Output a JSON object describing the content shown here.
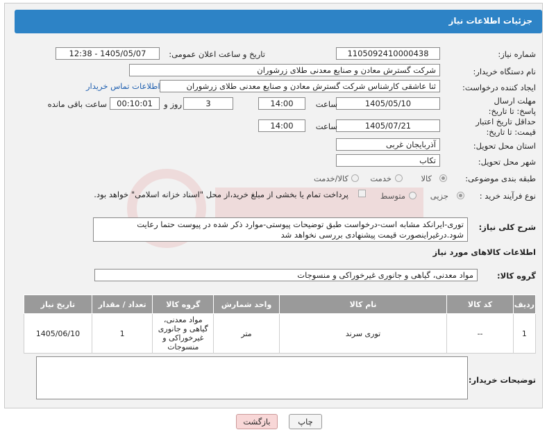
{
  "header": {
    "title": "جزئیات اطلاعات نیاز"
  },
  "fields": {
    "need_number_label": "شماره نیاز:",
    "need_number": "1105092410000438",
    "announce_label": "تاریخ و ساعت اعلان عمومی:",
    "announce_value": "1405/05/07 - 12:38",
    "buyer_org_label": "نام دستگاه خریدار:",
    "buyer_org": "شرکت گسترش معادن و صنایع معدنی طلای زرشوران",
    "creator_label": "ایجاد کننده درخواست:",
    "creator": "ثنا عاشقی کارشناس شرکت گسترش معادن و صنایع معدنی طلای زرشوران",
    "contact_link": "اطلاعات تماس خریدار",
    "deadline_label": "مهلت ارسال پاسخ: تا تاریخ:",
    "deadline_date": "1405/05/10",
    "time_label": "ساعت",
    "deadline_time": "14:00",
    "days_value": "3",
    "days_label": "روز و",
    "remaining_time": "00:10:01",
    "remaining_label": "ساعت باقی مانده",
    "validity_label": "حداقل تاریخ اعتبار قیمت: تا تاریخ:",
    "validity_date": "1405/07/21",
    "validity_time": "14:00",
    "province_label": "استان محل تحویل:",
    "province": "آذربایجان غربی",
    "city_label": "شهر محل تحویل:",
    "city": "تکاب",
    "category_label": "طبقه بندی موضوعی:",
    "category_options": [
      "کالا",
      "خدمت",
      "کالا/خدمت"
    ],
    "process_label": "نوع فرآیند خرید :",
    "process_options": [
      "جزیی",
      "متوسط"
    ],
    "payment_note": "پرداخت تمام یا بخشی از مبلغ خرید،از محل \"اسناد خزانه اسلامی\" خواهد بود."
  },
  "description": {
    "label": "شرح کلی نیاز:",
    "text": "توری-ایرانکد مشابه است-درخواست طبق توضیحات پیوستی-موارد ذکر شده در پیوست حتما رعایت شود.درغیراینصورت قیمت پیشنهادی بررسی نخواهد شد"
  },
  "goods": {
    "section_title": "اطلاعات کالاهای مورد نیاز",
    "group_label": "گروه کالا:",
    "group_value": "مواد معدنی، گیاهی و جانوری غیرخوراکی و منسوجات",
    "columns": [
      "ردیف",
      "کد کالا",
      "نام کالا",
      "واحد شمارش",
      "گروه کالا",
      "تعداد / مقدار",
      "تاریخ نیاز"
    ],
    "rows": [
      [
        "1",
        "--",
        "توری سرند",
        "متر",
        "مواد معدنی، گیاهی و جانوری غیرخوراکی و منسوجات",
        "1",
        "1405/06/10"
      ]
    ]
  },
  "buyer_notes": {
    "label": "توضیحات خریدار:",
    "text": ""
  },
  "buttons": {
    "print": "چاپ",
    "back": "بازگشت"
  },
  "colors": {
    "header_bg": "#2d83c6",
    "table_header_bg": "#9a9a9a",
    "back_button_bg": "#f8d7d7"
  }
}
